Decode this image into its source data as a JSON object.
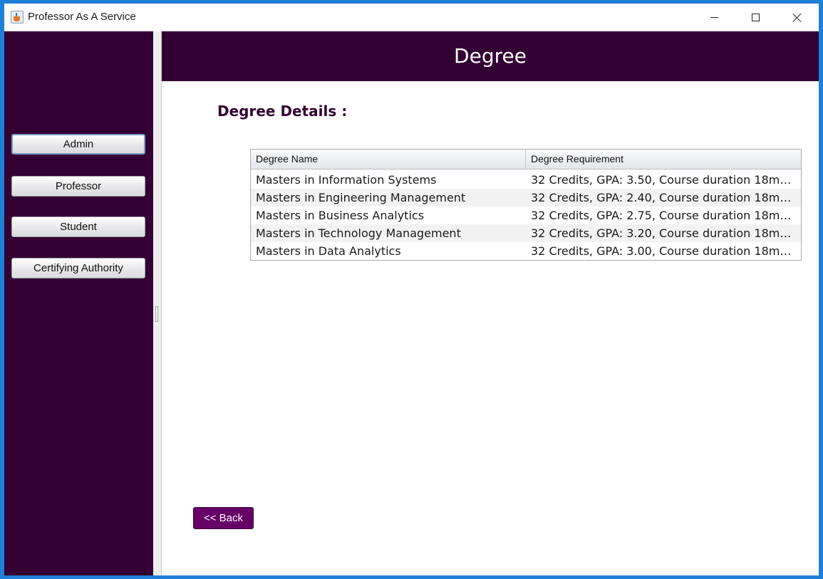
{
  "window": {
    "title": "Professor As A Service",
    "app_icon": "java-cup-icon",
    "controls": [
      "minimize-icon",
      "maximize-icon",
      "close-icon"
    ]
  },
  "sidebar": {
    "background": "#330033",
    "items": [
      {
        "label": "Admin",
        "focused": true
      },
      {
        "label": "Professor"
      },
      {
        "label": "Student"
      },
      {
        "label": "Certifying Authority"
      }
    ]
  },
  "header": {
    "title": "Degree",
    "background": "#330033"
  },
  "main": {
    "section_title": "Degree Details :",
    "table": {
      "columns": [
        "Degree Name",
        "Degree Requirement"
      ],
      "rows": [
        [
          "Masters in Information Systems",
          "32 Credits, GPA: 3.50, Course duration 18mo..."
        ],
        [
          "Masters in Engineering Management",
          "32 Credits, GPA: 2.40, Course duration 18mo..."
        ],
        [
          "Masters in Business Analytics",
          "32 Credits, GPA: 2.75, Course duration 18mo..."
        ],
        [
          "Masters in Technology Management",
          "32 Credits, GPA: 3.20, Course duration 18mo..."
        ],
        [
          "Masters in Data Analytics",
          "32 Credits, GPA: 3.00, Course duration 18mo..."
        ]
      ]
    },
    "back_button": {
      "label": "<< Back",
      "color": "#660066"
    }
  }
}
